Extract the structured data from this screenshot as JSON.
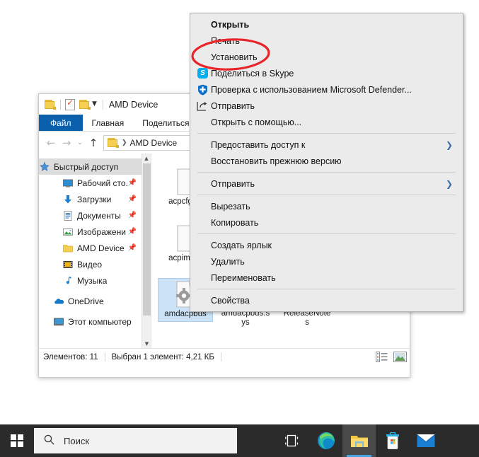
{
  "window": {
    "title": "AMD Device",
    "quick_access_icons": [
      "folder-icon",
      "properties-icon",
      "new-folder-icon",
      "dropdown-caret-icon"
    ],
    "ribbon_tabs": [
      {
        "label": "Файл",
        "active": true
      },
      {
        "label": "Главная",
        "active": false
      },
      {
        "label": "Поделиться",
        "active": false
      }
    ],
    "address": {
      "back_icon": "back-arrow-icon",
      "forward_icon": "forward-arrow-icon",
      "recent_icon": "recent-locations-icon",
      "up_icon": "up-arrow-icon",
      "crumbs": [
        "AMD Device"
      ]
    },
    "navpane": {
      "items": [
        {
          "label": "Быстрый доступ",
          "icon": "star-pin-icon",
          "indent": 0,
          "selected": true,
          "pinned": false
        },
        {
          "label": "Рабочий сто.",
          "icon": "desktop-icon",
          "indent": 1,
          "selected": false,
          "pinned": true
        },
        {
          "label": "Загрузки",
          "icon": "downloads-icon",
          "indent": 1,
          "selected": false,
          "pinned": true
        },
        {
          "label": "Документы",
          "icon": "documents-icon",
          "indent": 1,
          "selected": false,
          "pinned": true
        },
        {
          "label": "Изображени",
          "icon": "pictures-icon",
          "indent": 1,
          "selected": false,
          "pinned": true
        },
        {
          "label": "AMD Device",
          "icon": "folder-icon",
          "indent": 1,
          "selected": false,
          "pinned": true
        },
        {
          "label": "Видео",
          "icon": "videos-icon",
          "indent": 1,
          "selected": false,
          "pinned": false
        },
        {
          "label": "Музыка",
          "icon": "music-icon",
          "indent": 1,
          "selected": false,
          "pinned": false
        },
        {
          "label": "OneDrive",
          "icon": "onedrive-cloud-icon",
          "indent": 0,
          "selected": false,
          "pinned": false
        },
        {
          "label": "Этот компьютер",
          "icon": "this-pc-icon",
          "indent": 0,
          "selected": false,
          "pinned": false
        }
      ],
      "scrollbar": {
        "up_icon": "chevron-up-icon",
        "down_icon": "chevron-down-icon"
      }
    },
    "files": [
      {
        "name": "acpcfg.da",
        "icon": "file-blank-icon",
        "selected": false,
        "col": 0,
        "row": 0
      },
      {
        "name": "acpim 2.d",
        "icon": "file-blank-icon",
        "selected": false,
        "col": 0,
        "row": 1
      },
      {
        "name": "amdacpbus",
        "icon": "gear-file-icon",
        "selected": true,
        "col": 0,
        "row": 2
      },
      {
        "name": "amdacpbus.sys",
        "icon": "gears-file-icon",
        "selected": false,
        "col": 1,
        "row": 2
      },
      {
        "name": "ReleaseNotes",
        "icon": "text-file-icon",
        "selected": false,
        "col": 2,
        "row": 2
      }
    ],
    "statusbar": {
      "count_text": "Элементов: 11",
      "selection_text": "Выбран 1 элемент: 4,21 КБ",
      "view_details_icon": "details-view-icon",
      "view_thumbnails_icon": "large-icons-view-icon"
    }
  },
  "context_menu": {
    "items": [
      {
        "label": "Открыть",
        "bold": true,
        "icon": null,
        "submenu": false
      },
      {
        "label": "Печать",
        "bold": false,
        "icon": null,
        "submenu": false
      },
      {
        "label": "Установить",
        "bold": false,
        "icon": null,
        "submenu": false
      },
      {
        "label": "Поделиться в Skype",
        "bold": false,
        "icon": "skype-icon",
        "submenu": false
      },
      {
        "label": "Проверка с использованием Microsoft Defender...",
        "bold": false,
        "icon": "shield-icon",
        "submenu": false
      },
      {
        "label": "Отправить",
        "bold": false,
        "icon": "share-arrow-icon",
        "submenu": false
      },
      {
        "label": "Открыть с помощью...",
        "bold": false,
        "icon": null,
        "submenu": false
      },
      {
        "separator": true
      },
      {
        "label": "Предоставить доступ к",
        "bold": false,
        "icon": null,
        "submenu": true
      },
      {
        "label": "Восстановить прежнюю версию",
        "bold": false,
        "icon": null,
        "submenu": false
      },
      {
        "separator": true
      },
      {
        "label": "Отправить",
        "bold": false,
        "icon": null,
        "submenu": true
      },
      {
        "separator": true
      },
      {
        "label": "Вырезать",
        "bold": false,
        "icon": null,
        "submenu": false
      },
      {
        "label": "Копировать",
        "bold": false,
        "icon": null,
        "submenu": false
      },
      {
        "separator": true
      },
      {
        "label": "Создать ярлык",
        "bold": false,
        "icon": null,
        "submenu": false
      },
      {
        "label": "Удалить",
        "bold": false,
        "icon": null,
        "submenu": false
      },
      {
        "label": "Переименовать",
        "bold": false,
        "icon": null,
        "submenu": false
      },
      {
        "separator": true
      },
      {
        "label": "Свойства",
        "bold": false,
        "icon": null,
        "submenu": false
      }
    ]
  },
  "annotation": {
    "type": "red-ellipse-highlight",
    "target_label": "Установить",
    "color": "#e8262a"
  },
  "taskbar": {
    "start_icon": "windows-logo-icon",
    "search": {
      "placeholder": "Поиск",
      "value": "",
      "icon": "search-icon"
    },
    "icons": [
      {
        "name": "task-view-icon",
        "active": false
      },
      {
        "name": "edge-browser-icon",
        "active": false
      },
      {
        "name": "file-explorer-icon",
        "active": true
      },
      {
        "name": "microsoft-store-icon",
        "active": false
      },
      {
        "name": "mail-icon",
        "active": false
      }
    ],
    "background_color": "#2b2b2b"
  }
}
